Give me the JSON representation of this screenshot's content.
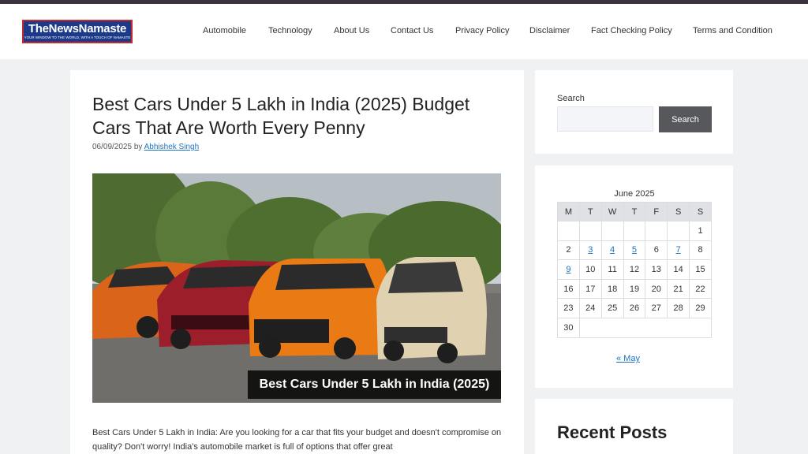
{
  "header": {
    "logo": {
      "main": "TheNewsNamaste",
      "tagline": "YOUR WINDOW TO THE WORLD, WITH A TOUCH OF NAMASTE"
    },
    "nav": [
      {
        "label": "Automobile"
      },
      {
        "label": "Technology"
      },
      {
        "label": "About Us"
      },
      {
        "label": "Contact Us"
      },
      {
        "label": "Privacy Policy"
      },
      {
        "label": "Disclaimer"
      },
      {
        "label": "Fact Checking Policy"
      },
      {
        "label": "Terms and Condition"
      }
    ]
  },
  "article": {
    "title": "Best Cars Under 5 Lakh in India (2025) Budget Cars That Are Worth Every Penny",
    "date": "06/09/2025",
    "by": "by",
    "author": "Abhishek Singh",
    "hero_caption": "Best Cars Under 5 Lakh in India (2025)",
    "intro": "Best Cars Under 5 Lakh in India: Are you looking for a car that fits your budget and doesn't compromise on quality? Don't worry! India's automobile market is full of options that offer great"
  },
  "sidebar": {
    "search": {
      "label": "Search",
      "value": "",
      "button": "Search"
    },
    "calendar": {
      "caption": "June 2025",
      "days": [
        "M",
        "T",
        "W",
        "T",
        "F",
        "S",
        "S"
      ],
      "weeks": [
        [
          "",
          "",
          "",
          "",
          "",
          "",
          "1"
        ],
        [
          "2",
          "3",
          "4",
          "5",
          "6",
          "7",
          "8"
        ],
        [
          "9",
          "10",
          "11",
          "12",
          "13",
          "14",
          "15"
        ],
        [
          "16",
          "17",
          "18",
          "19",
          "20",
          "21",
          "22"
        ],
        [
          "23",
          "24",
          "25",
          "26",
          "27",
          "28",
          "29"
        ],
        [
          "30"
        ]
      ],
      "linked_days": [
        "3",
        "4",
        "5",
        "7",
        "9"
      ],
      "prev": "« May"
    },
    "recent_posts_title": "Recent Posts"
  },
  "colors": {
    "link": "#1e73be",
    "button": "#56585c",
    "logo_bg": "#1d3a8a",
    "logo_border": "#c22b2b"
  }
}
